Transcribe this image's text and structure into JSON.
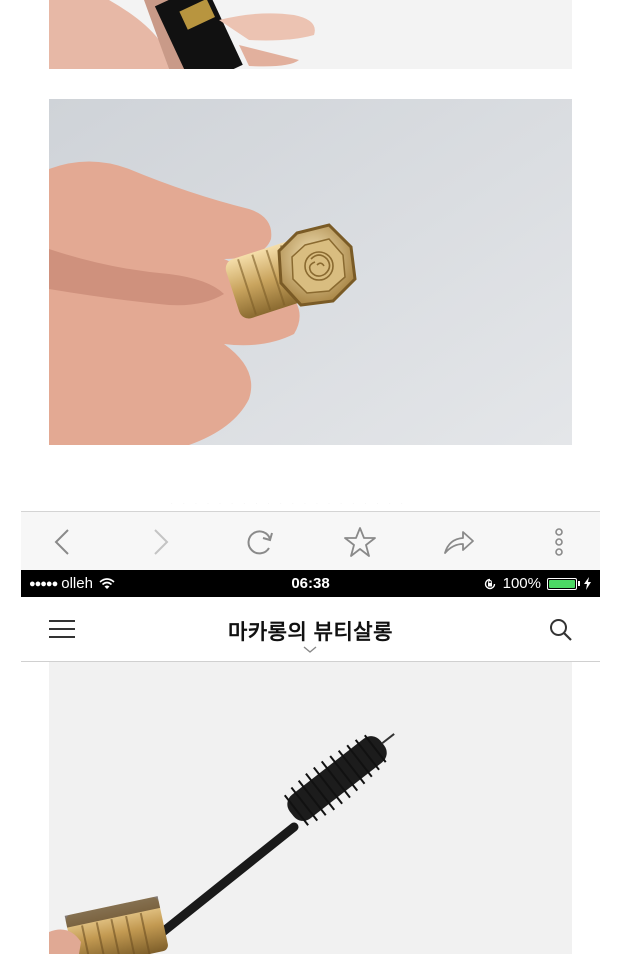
{
  "browser_toolbar": {
    "buttons": [
      {
        "id": "back",
        "icon": "chevron-left-icon"
      },
      {
        "id": "forward",
        "icon": "chevron-right-icon"
      },
      {
        "id": "reload",
        "icon": "reload-icon"
      },
      {
        "id": "bookmark",
        "icon": "star-icon"
      },
      {
        "id": "share",
        "icon": "share-arrow-icon"
      },
      {
        "id": "more",
        "icon": "more-vertical-icon"
      }
    ]
  },
  "status_bar": {
    "signal": "●●●●●",
    "carrier": "olleh",
    "time": "06:38",
    "battery_percent": "100%",
    "battery_level": 1.0,
    "battery_color": "#4cd964"
  },
  "app_header": {
    "title": "마카롱의 뷰티살롱",
    "menu_icon": "hamburger-menu-icon",
    "search_icon": "search-icon"
  },
  "photos": [
    {
      "id": "photo-top",
      "subject": "hand holding mascara tube"
    },
    {
      "id": "photo-mid",
      "subject": "hand holding gold mascara cap"
    },
    {
      "id": "photo-bot",
      "subject": "mascara wand brush"
    }
  ]
}
